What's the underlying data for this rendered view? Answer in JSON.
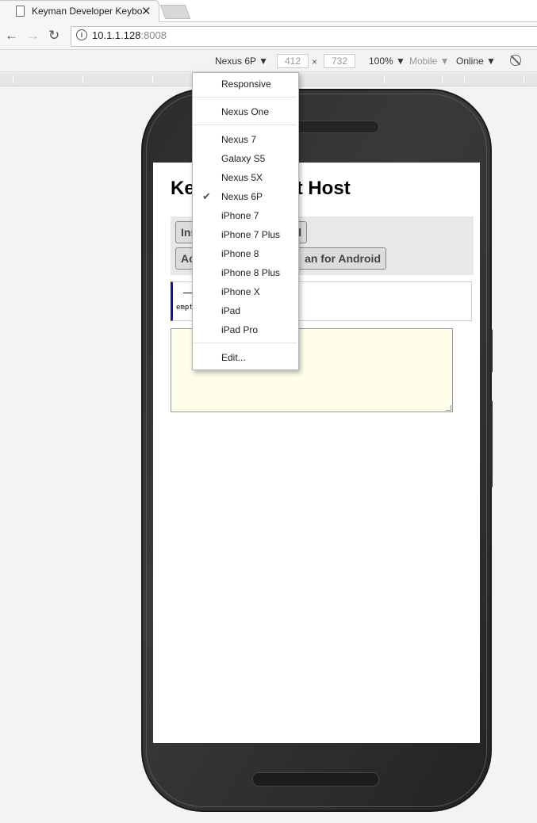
{
  "browser": {
    "tab_title": "Keyman Developer Keybo",
    "tab_close": "✕",
    "url_host": "10.1.1.128",
    "url_port": ":8008"
  },
  "device_toolbar": {
    "device": "Nexus 6P ▼",
    "width": "412",
    "times": "×",
    "height": "732",
    "zoom": "100% ▼",
    "mode": "Mobile ▼",
    "network": "Online ▼"
  },
  "device_menu": {
    "items": [
      "Responsive",
      "Nexus One",
      "Nexus 7",
      "Galaxy S5",
      "Nexus 5X",
      "Nexus 6P",
      "iPhone 7",
      "iPhone 7 Plus",
      "iPhone 8",
      "iPhone 8 Plus",
      "iPhone X",
      "iPad",
      "iPad Pro",
      "Edit..."
    ],
    "selected": "Nexus 6P",
    "checkmark": "✔"
  },
  "page": {
    "title_left": "Ke",
    "title_right": "t Host",
    "btn1_left": "Ins",
    "btn1_right": "d",
    "btn2_left": "Ac",
    "btn2_right": "an for Android",
    "info_dash": "—",
    "info_mono": "empt"
  },
  "icons": [
    "page-icon",
    "back-arrow-icon",
    "forward-arrow-icon",
    "reload-icon",
    "info-icon",
    "rotate-icon",
    "check-icon"
  ]
}
